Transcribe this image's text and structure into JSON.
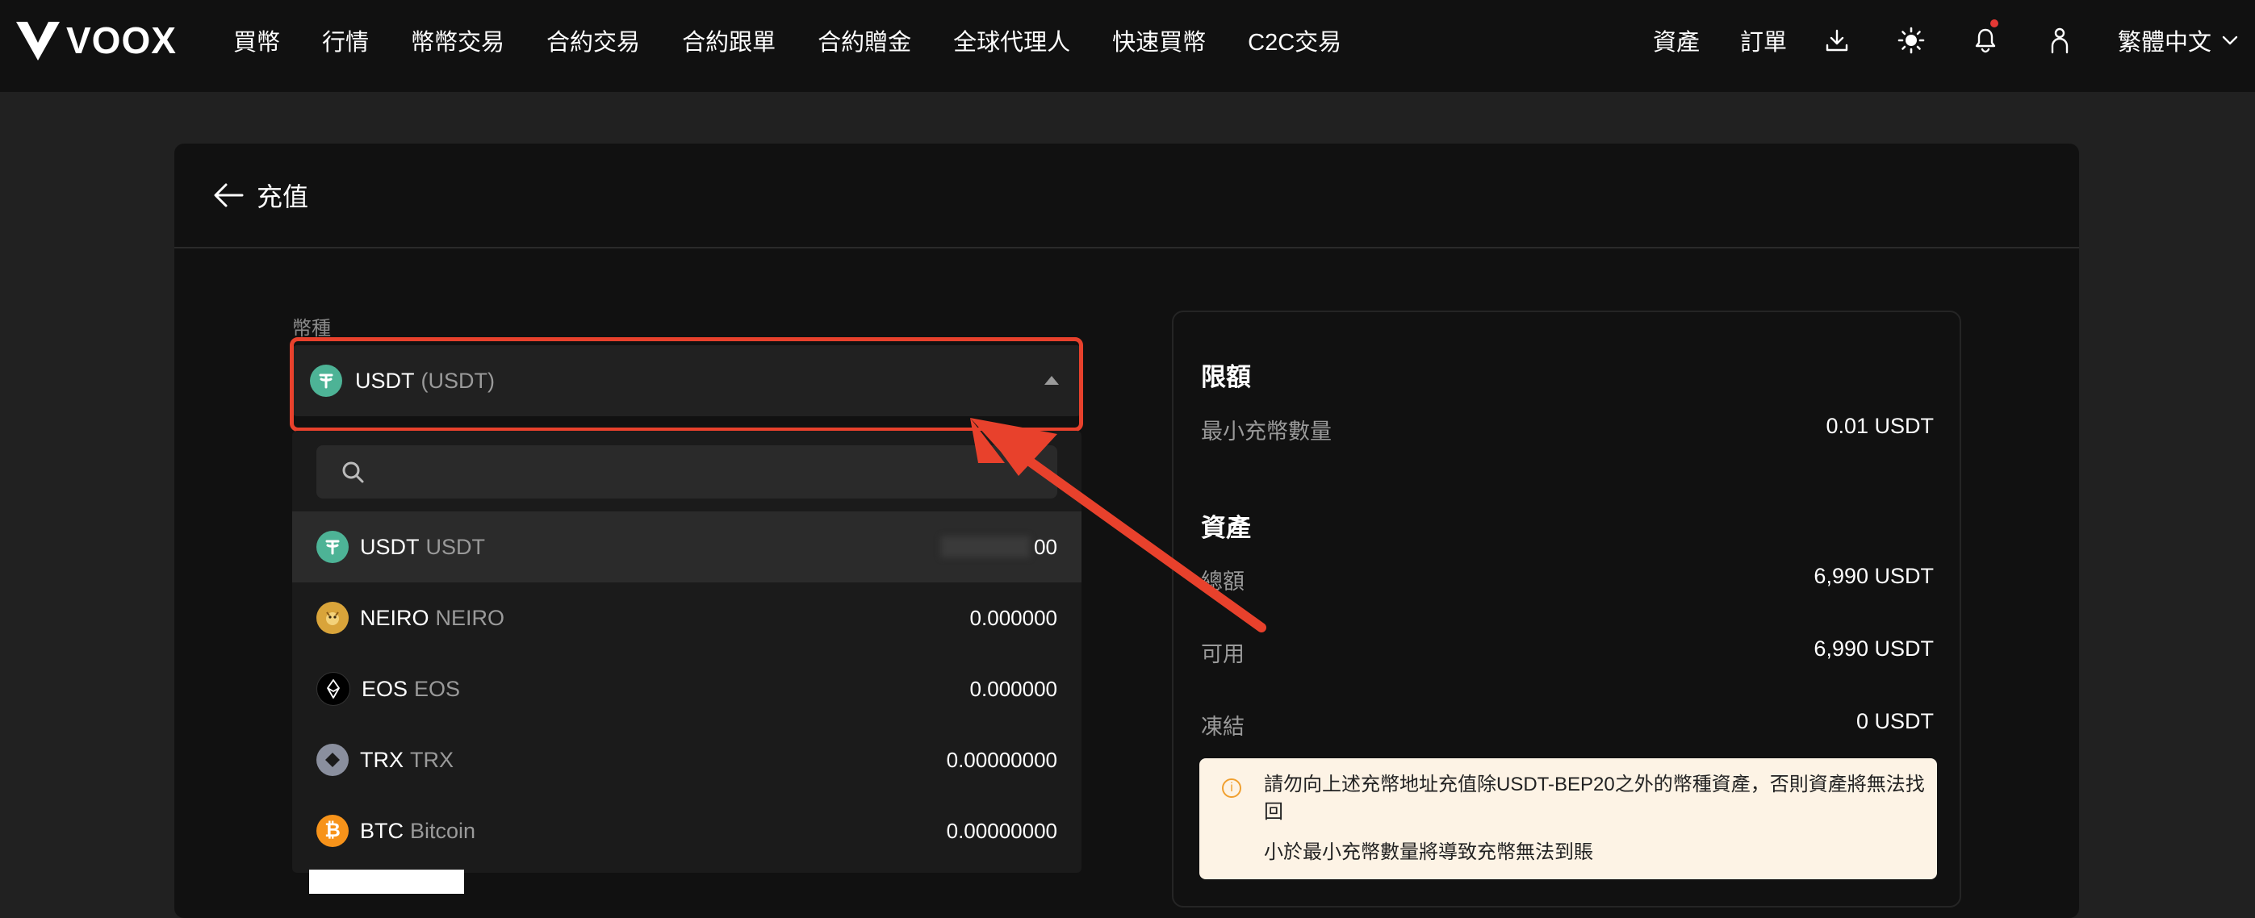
{
  "brand": {
    "name": "VOOX"
  },
  "nav": {
    "left": [
      "買幣",
      "行情",
      "幣幣交易",
      "合約交易",
      "合約跟單",
      "合約贈金",
      "全球代理人",
      "快速買幣",
      "C2C交易"
    ],
    "right": {
      "assets": "資產",
      "orders": "訂單",
      "language": "繁體中文"
    },
    "icons": [
      "download-icon",
      "sun-icon",
      "bell-icon",
      "user-icon",
      "chevron-down-icon"
    ]
  },
  "page": {
    "title": "充值"
  },
  "coin_field": {
    "label": "幣種",
    "selected_name": "USDT",
    "selected_sub": "(USDT)",
    "search_placeholder": ""
  },
  "options": [
    {
      "symbol": "USDT",
      "name": "USDT",
      "balance": "00",
      "color": "#4db396"
    },
    {
      "symbol": "NEIRO",
      "name": "NEIRO",
      "balance": "0.000000",
      "color": "#d9a43a"
    },
    {
      "symbol": "EOS",
      "name": "EOS",
      "balance": "0.000000",
      "color": "#000000"
    },
    {
      "symbol": "TRX",
      "name": "TRX",
      "balance": "0.00000000",
      "color": "#8a8f9e"
    },
    {
      "symbol": "BTC",
      "name": "Bitcoin",
      "balance": "0.00000000",
      "color": "#f7931a"
    }
  ],
  "limits": {
    "title": "限額",
    "min_label": "最小充幣數量",
    "min_value": "0.01 USDT"
  },
  "assets": {
    "title": "資產",
    "total_label": "總額",
    "total_value": "6,990 USDT",
    "available_label": "可用",
    "available_value": "6,990 USDT",
    "frozen_label": "凍結",
    "frozen_value": "0 USDT"
  },
  "warning": {
    "line1": "請勿向上述充幣地址充值除USDT-BEP20之外的幣種資產，否則資產將無法找回",
    "line2": "小於最小充幣數量將導致充幣無法到賬"
  },
  "colors": {
    "highlight": "#e8412c",
    "page_bg": "#212121",
    "panel_bg": "#111111",
    "warning_bg": "#fdf3e5"
  }
}
